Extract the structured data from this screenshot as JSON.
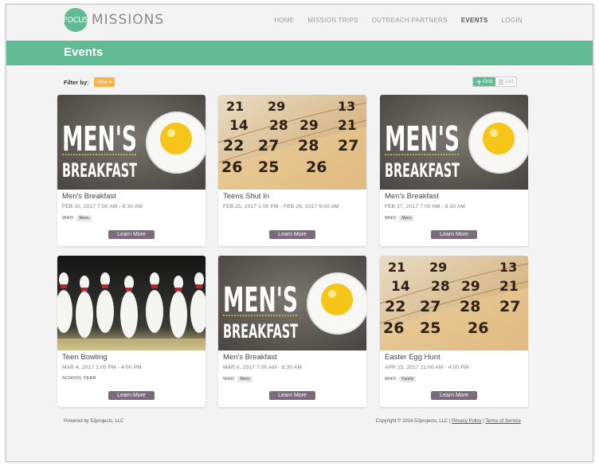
{
  "header": {
    "logo_mark": "FOCUS",
    "logo_text": "MISSIONS",
    "nav": [
      {
        "label": "HOME"
      },
      {
        "label": "MISSION TRIPS"
      },
      {
        "label": "OUTREACH PARTNERS"
      },
      {
        "label": "EVENTS",
        "active": true
      },
      {
        "label": "LOGIN"
      }
    ]
  },
  "page": {
    "title": "Events"
  },
  "filter": {
    "label": "Filter by:",
    "button": "Who"
  },
  "view_toggle": {
    "grid": "Grid",
    "list": "List",
    "selected": "Grid"
  },
  "cards": [
    {
      "image": "mens-breakfast",
      "title": "Men's Breakfast",
      "date": "FEB 20, 2017 7:00 AM - 8:30 AM",
      "meta_label": "WHO",
      "badge": "Mens",
      "button": "Learn More"
    },
    {
      "image": "calendar",
      "title": "Teens Shut In",
      "date": "FEB 25, 2017 1:00 PM - FEB 26, 2017 9:00 AM",
      "meta_label": "",
      "badge": "",
      "button": "Learn More"
    },
    {
      "image": "mens-breakfast",
      "title": "Men's Breakfast",
      "date": "FEB 27, 2017 7:00 AM - 8:30 AM",
      "meta_label": "WHO",
      "badge": "Mens",
      "button": "Learn More"
    },
    {
      "image": "bowling",
      "title": "Teen Bowling",
      "date": "MAR 4, 2017 2:00 PM - 4:00 PM",
      "meta_label": "SCHOOL YEAR",
      "badge": "",
      "button": "Learn More"
    },
    {
      "image": "mens-breakfast",
      "title": "Men's Breakfast",
      "date": "MAR 6, 2017 7:00 AM - 8:30 AM",
      "meta_label": "WHO",
      "badge": "Mens",
      "button": "Learn More"
    },
    {
      "image": "calendar",
      "title": "Easter Egg Hunt",
      "date": "APR 15, 2017 11:00 AM - 4:00 PM",
      "meta_label": "WHO",
      "badge": "Family",
      "button": "Learn More"
    }
  ],
  "image_text": {
    "mens_line1": "MEN'S",
    "mens_line2": "BREAKFAST",
    "calendar_numbers": [
      "21",
      "29",
      "13",
      "14",
      "28",
      "29",
      "21",
      "22",
      "27",
      "28",
      "27",
      "28",
      "26",
      "25",
      "26"
    ]
  },
  "footer": {
    "left": "Powered by 52projects, LLC",
    "copyright": "Copyright © 2016 52projects, LLC |",
    "privacy": "Privacy Policy",
    "separator": "|",
    "terms": "Terms of Service"
  },
  "colors": {
    "brand_green": "#5fba95",
    "filter_orange": "#f5b445",
    "button_purple": "#7a6a7c"
  }
}
